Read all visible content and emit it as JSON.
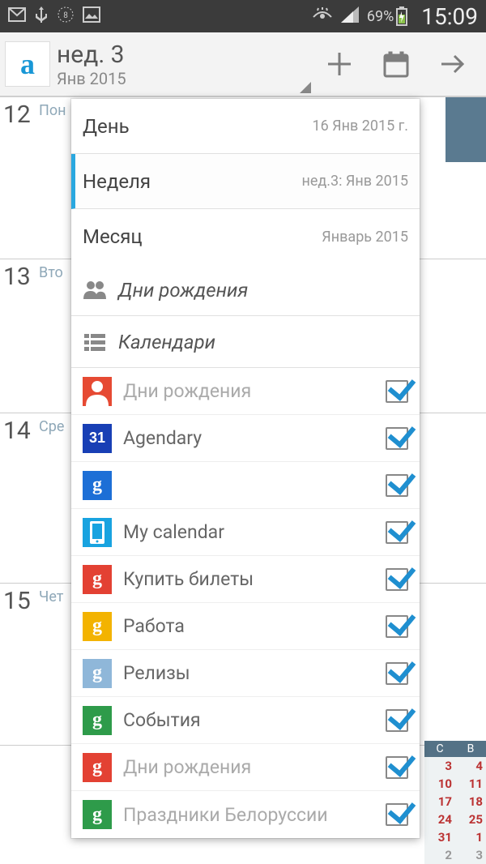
{
  "status": {
    "battery": "69%",
    "time": "15:09"
  },
  "appbar": {
    "title": "нед. 3",
    "subtitle": "Янв 2015"
  },
  "days": [
    {
      "num": "12",
      "label": "Пон"
    },
    {
      "num": "13",
      "label": "Вто"
    },
    {
      "num": "14",
      "label": "Сре"
    },
    {
      "num": "15",
      "label": "Чет"
    }
  ],
  "mini": {
    "h1": "С",
    "h2": "В",
    "rows": [
      [
        "3",
        "4"
      ],
      [
        "10",
        "11"
      ],
      [
        "17",
        "18"
      ],
      [
        "24",
        "25"
      ],
      [
        "31",
        "1"
      ]
    ]
  },
  "popup": {
    "views": [
      {
        "label": "День",
        "sub": "16 Янв 2015 г.",
        "selected": false
      },
      {
        "label": "Неделя",
        "sub": "нед.3: Янв 2015",
        "selected": true
      },
      {
        "label": "Месяц",
        "sub": "Январь 2015",
        "selected": false
      }
    ],
    "section_birthdays": "Дни рождения",
    "section_calendars": "Календари",
    "calendars": [
      {
        "name": "Дни рождения",
        "gray": true,
        "icon": "person",
        "color": "#e64a33"
      },
      {
        "name": "Agendary",
        "gray": false,
        "icon": "31",
        "color": "#183fb5"
      },
      {
        "name": "",
        "gray": false,
        "icon": "g",
        "color": "#1d6fd6"
      },
      {
        "name": "My calendar",
        "gray": false,
        "icon": "phone",
        "color": "#18a3e0"
      },
      {
        "name": "Купить билеты",
        "gray": false,
        "icon": "g",
        "color": "#e34133"
      },
      {
        "name": "Работа",
        "gray": false,
        "icon": "g",
        "color": "#f3b300"
      },
      {
        "name": "Релизы",
        "gray": false,
        "icon": "g",
        "color": "#8fb7d9"
      },
      {
        "name": "События",
        "gray": false,
        "icon": "g",
        "color": "#2e9b4a"
      },
      {
        "name": "Дни рождения",
        "gray": true,
        "icon": "g",
        "color": "#e34133"
      },
      {
        "name": "Праздники Белоруссии",
        "gray": true,
        "icon": "g",
        "color": "#2e9b4a"
      }
    ]
  }
}
